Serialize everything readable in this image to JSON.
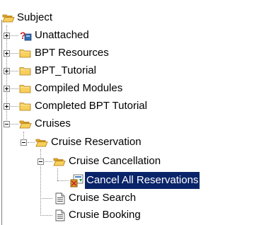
{
  "tree": {
    "root": {
      "label": "Subject",
      "icon": "folder-open-icon"
    },
    "items": [
      {
        "label": "Unattached",
        "icon": "unattached-question-icon",
        "state": "collapsed"
      },
      {
        "label": "BPT Resources",
        "icon": "folder-icon",
        "state": "collapsed"
      },
      {
        "label": "BPT_Tutorial",
        "icon": "folder-icon",
        "state": "collapsed"
      },
      {
        "label": "Compiled Modules",
        "icon": "folder-icon",
        "state": "collapsed"
      },
      {
        "label": "Completed BPT Tutorial",
        "icon": "folder-icon",
        "state": "collapsed"
      },
      {
        "label": "Cruises",
        "icon": "folder-open-icon",
        "state": "expanded"
      },
      {
        "label": "Cruise Reservation",
        "icon": "folder-open-icon",
        "state": "expanded"
      },
      {
        "label": "Cruise Cancellation",
        "icon": "folder-open-icon",
        "state": "expanded"
      },
      {
        "label": "Cancel All Reservations",
        "icon": "business-component-icon",
        "state": "selected"
      },
      {
        "label": "Cruise Search",
        "icon": "document-icon",
        "state": "leaf"
      },
      {
        "label": "Crusie Booking",
        "icon": "document-icon",
        "state": "leaf"
      }
    ]
  },
  "colors": {
    "selection": "#0a246a",
    "folder": "#f5c542",
    "connector": "#8c8c8c"
  }
}
